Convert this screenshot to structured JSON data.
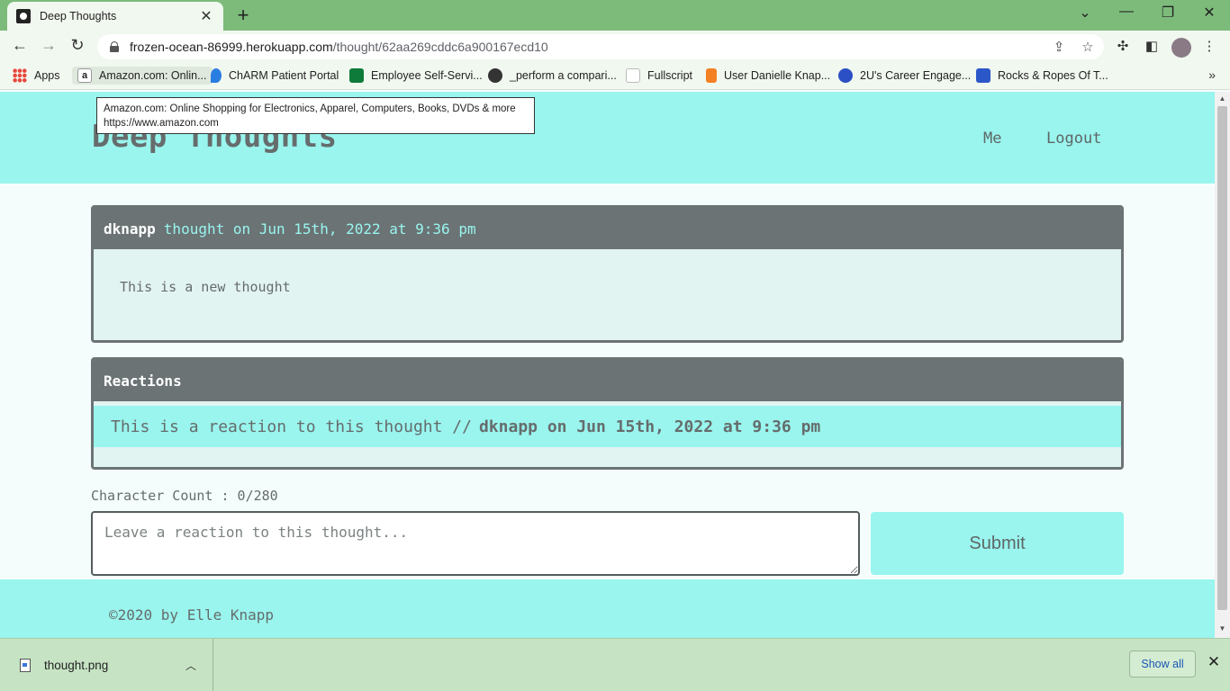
{
  "browser": {
    "tab_title": "Deep Thoughts",
    "url_host": "frozen-ocean-86999.herokuapp.com",
    "url_path": "/thought/62aa269cddc6a900167ecd10",
    "bookmarks": [
      {
        "label": "Apps",
        "icon": "apps-grid-icon",
        "color": "#e8453c"
      },
      {
        "label": "Amazon.com: Onlin...",
        "icon": "amazon-icon",
        "color": "#222222"
      },
      {
        "label": "ChARM Patient Portal",
        "icon": "charm-icon",
        "color": "#2a7de1"
      },
      {
        "label": "Employee Self-Servi...",
        "icon": "employee-portal-icon",
        "color": "#0f7b3b"
      },
      {
        "label": "_perform a compari...",
        "icon": "globe-icon",
        "color": "#333333"
      },
      {
        "label": "Fullscript",
        "icon": "fullscript-icon",
        "color": "#7cb342"
      },
      {
        "label": "User Danielle Knap...",
        "icon": "stackoverflow-icon",
        "color": "#f48024"
      },
      {
        "label": "2U's Career Engage...",
        "icon": "2u-icon",
        "color": "#2b4fc4"
      },
      {
        "label": "Rocks & Ropes Of T...",
        "icon": "pinterest-p-icon",
        "color": "#2b57c9"
      }
    ],
    "tooltip": {
      "line1": "Amazon.com: Online Shopping for Electronics, Apparel, Computers, Books, DVDs & more",
      "line2": "https://www.amazon.com"
    }
  },
  "site": {
    "title": "Deep Thoughts",
    "nav": {
      "me": "Me",
      "logout": "Logout"
    }
  },
  "thought": {
    "username": "dknapp",
    "meta": "thought on Jun 15th, 2022 at 9:36 pm",
    "text": "This is a new thought"
  },
  "reactions": {
    "title": "Reactions",
    "items": [
      {
        "body": "This is a reaction to this thought //",
        "author_line": "dknapp on Jun 15th, 2022 at 9:36 pm"
      }
    ]
  },
  "form": {
    "char_count": "Character Count : 0/280",
    "placeholder": "Leave a reaction to this thought...",
    "submit_label": "Submit"
  },
  "footer": {
    "text": "©2020 by Elle Knapp"
  },
  "downloads": {
    "file_name": "thought.png",
    "show_all": "Show all"
  },
  "colors": {
    "accent": "#99f5ee",
    "card_header": "#6b7375",
    "text": "#666c6c",
    "chrome": "#7dbb7b"
  }
}
